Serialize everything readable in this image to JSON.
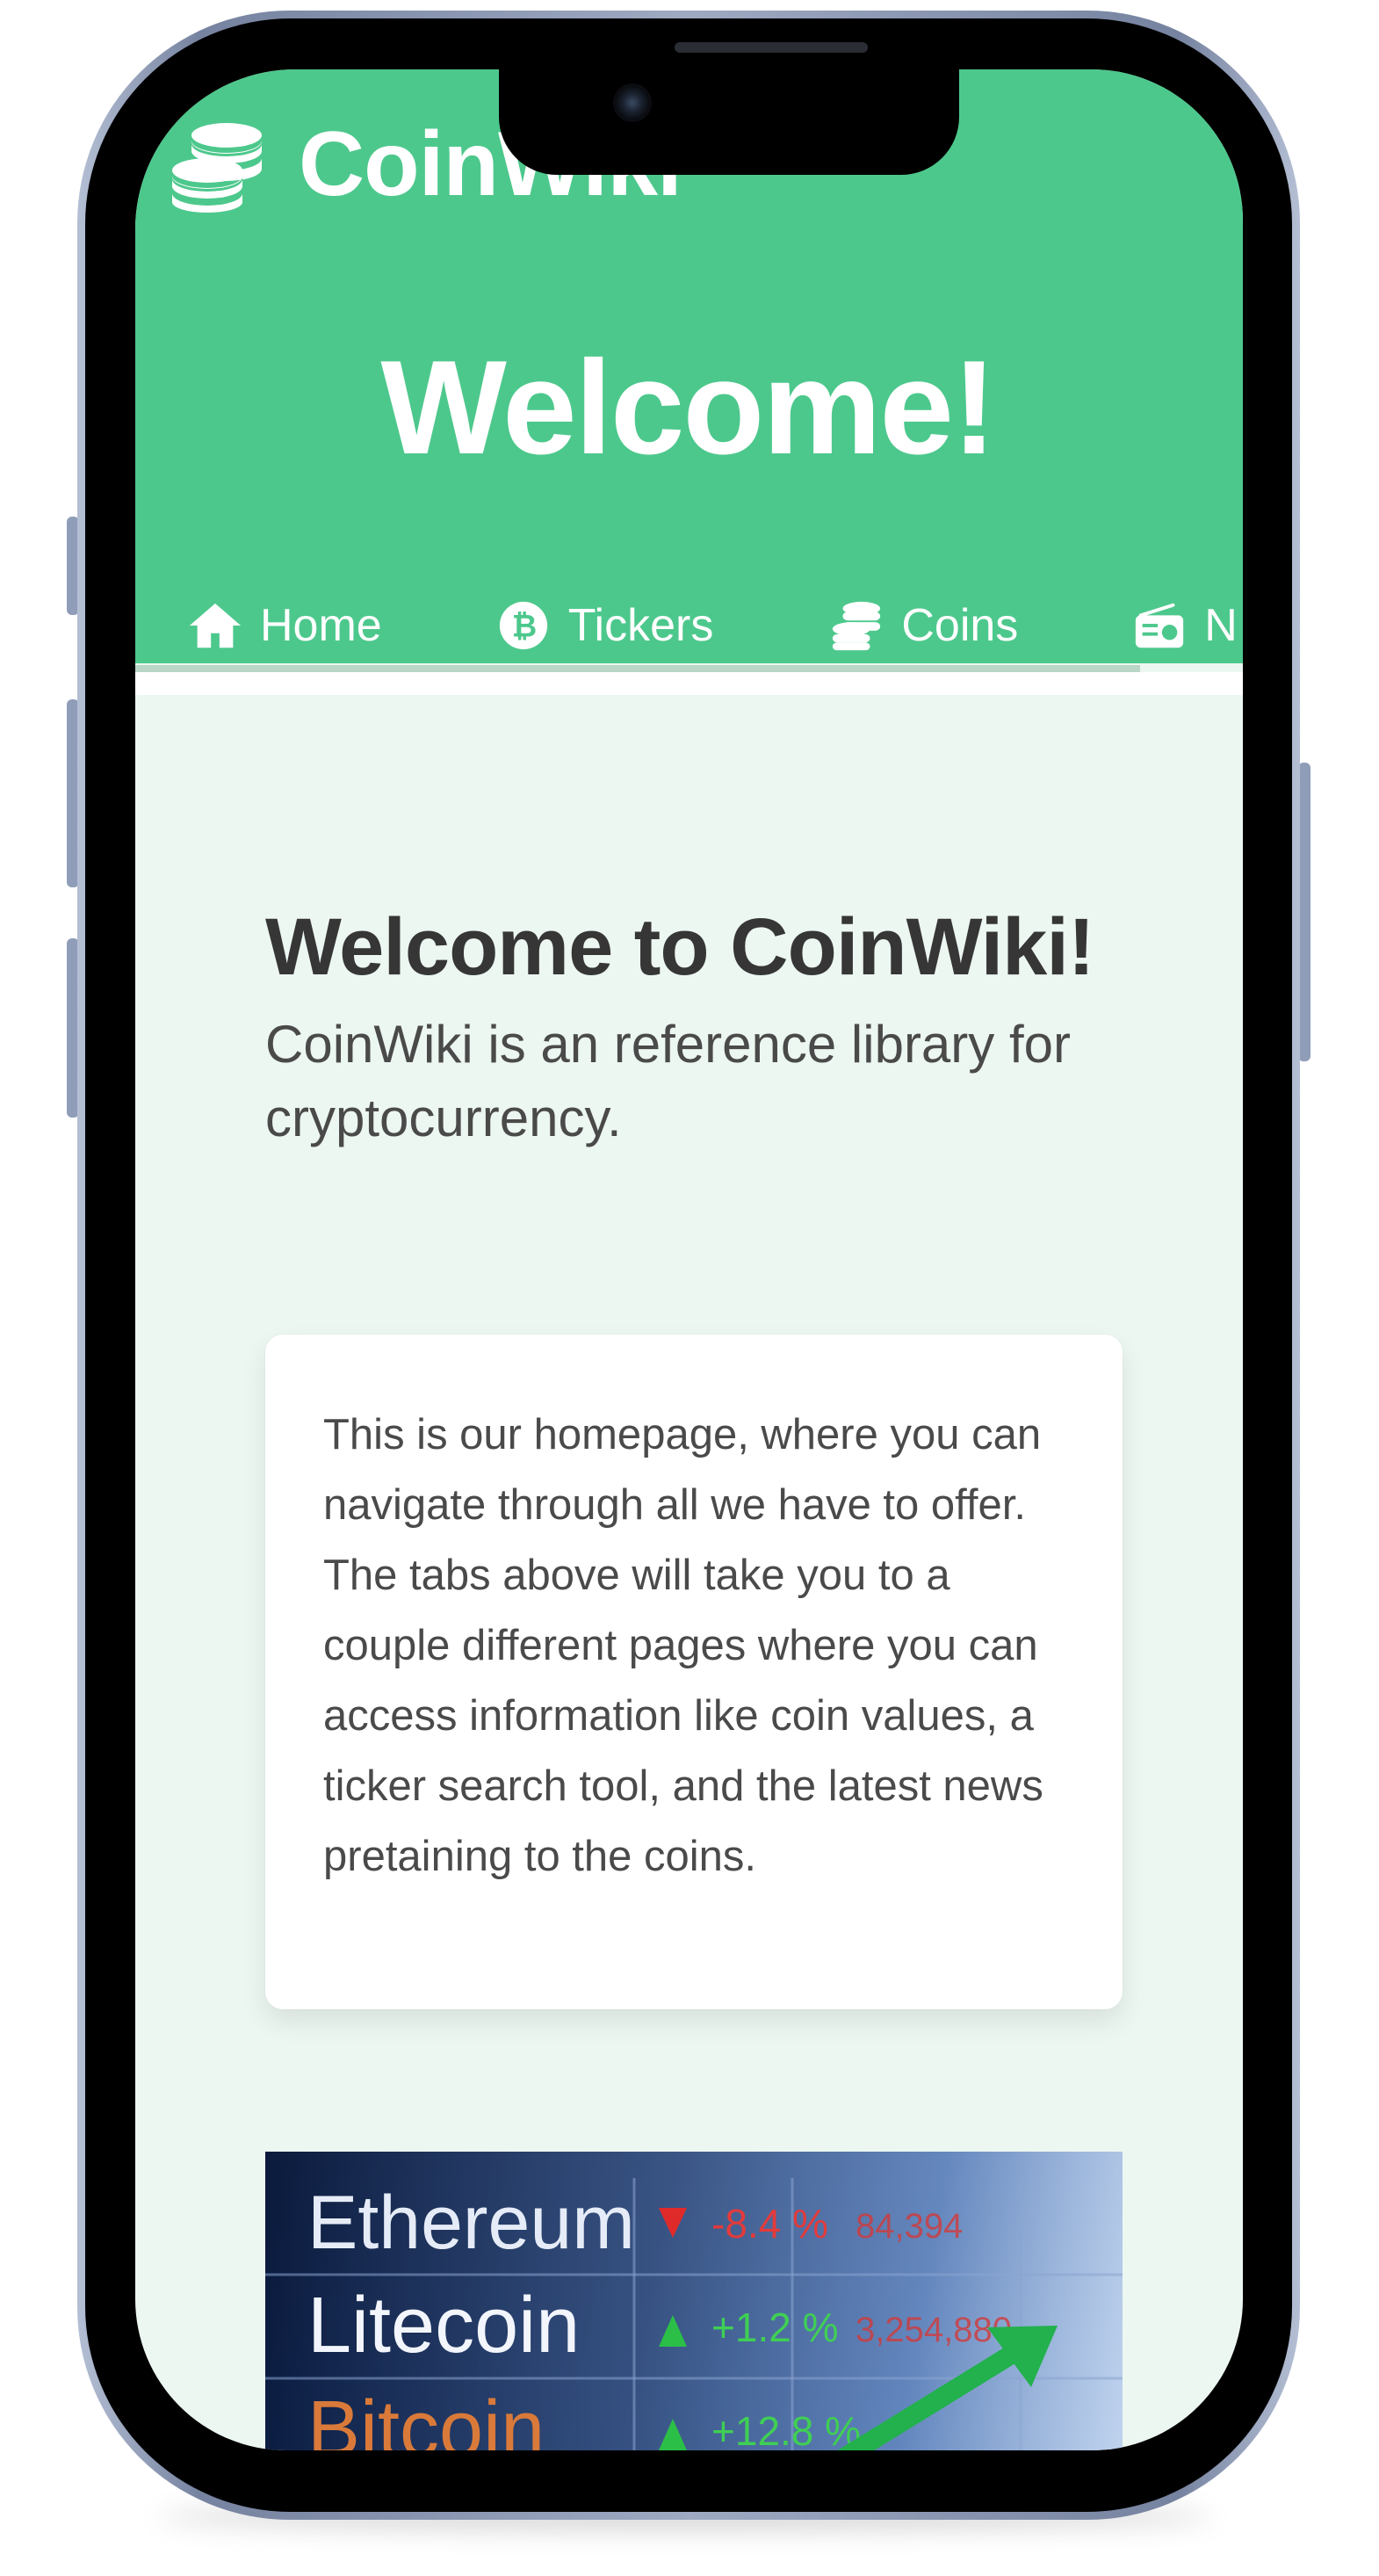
{
  "app": {
    "name": "CoinWiki",
    "hero_title": "Welcome!",
    "theme_color": "#4dc88c"
  },
  "tabs": [
    {
      "label": "Home",
      "icon": "home-icon"
    },
    {
      "label": "Tickers",
      "icon": "bitcoin-icon"
    },
    {
      "label": "Coins",
      "icon": "coins-icon"
    },
    {
      "label": "N",
      "icon": "radio-icon"
    }
  ],
  "main": {
    "title": "Welcome to CoinWiki!",
    "subtitle": "CoinWiki is an reference library for cryptocurrency.",
    "card_text": "This is our homepage, where you can navigate through all we have to offer. The tabs above will take you to a couple different pages where you can access information like coin values, a ticker search tool, and the latest news pretaining to the coins."
  },
  "banner": {
    "rows": [
      {
        "name": "Ethereum",
        "change": "-8.4 %",
        "value": "84,394",
        "direction": "down"
      },
      {
        "name": "Litecoin",
        "change": "+1.2 %",
        "value": "3,254,880",
        "direction": "up"
      },
      {
        "name": "Bitcoin",
        "change": "+12.8 %",
        "value": "",
        "direction": "up"
      }
    ]
  }
}
